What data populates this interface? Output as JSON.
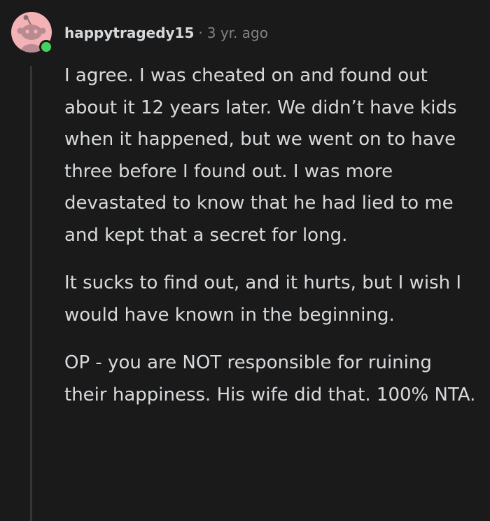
{
  "comment": {
    "username": "happytragedy15",
    "separator": "·",
    "age": "3 yr. ago",
    "avatar_icon": "snoo-avatar-icon",
    "online_status_icon": "online-dot-icon",
    "paragraphs": [
      "I agree. I was cheated on and found out about it 12 years later. We didn’t have kids when it happened, but we went on to have three before I found out. I was more devastated to know that he had lied to me and kept that a secret for long.",
      "It sucks to find out, and it hurts, but I wish I would have known in the beginning.",
      "OP - you are NOT responsible for ruining their happiness. His wife did that. 100% NTA."
    ]
  },
  "colors": {
    "background": "#1a1a1b",
    "text": "#d7dadc",
    "muted": "#818384",
    "avatar_bg": "#f3b3b6",
    "online": "#46d160",
    "thread_line": "#343536"
  }
}
